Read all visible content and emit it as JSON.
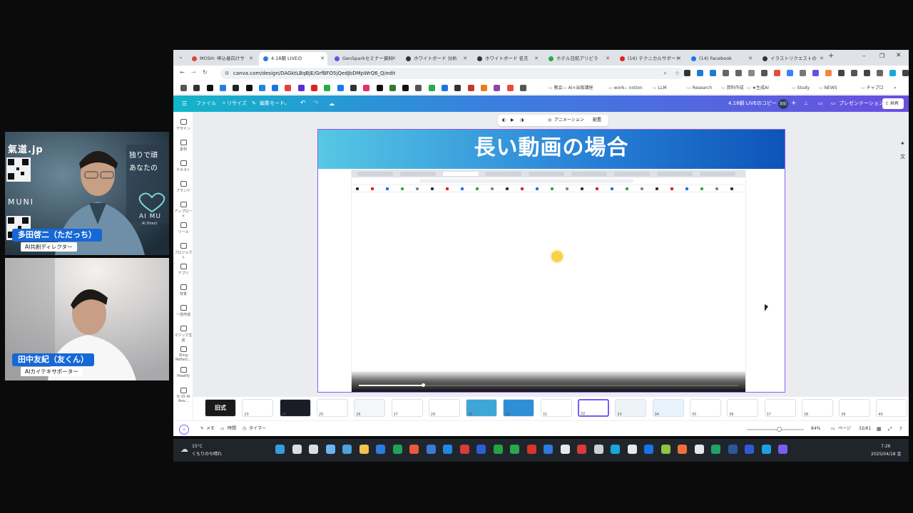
{
  "cams": {
    "top": {
      "name": "多田啓二（ただっち）",
      "role": "AI共創ディレクター",
      "overlay_site": "氣道.jp",
      "overlay_logo": "MUNI",
      "overlay_banner_1": "独りで頑",
      "overlay_banner_2": "あなたの",
      "overlay_brand": "AI MU",
      "overlay_brand_sub": "AI Direct"
    },
    "bottom": {
      "name": "田中友紀（友くん）",
      "role": "AIカイテキサポーター"
    }
  },
  "browser": {
    "tabs": [
      {
        "label": "MOSH: 申込者向けサ",
        "color": "#e0443c"
      },
      {
        "label": "4.18朝 LIVEの",
        "color": "#2d7be0",
        "active": true
      },
      {
        "label": "GenSparkセミナー資料",
        "color": "#6b4fe0"
      },
      {
        "label": "ホワイトボード 分析",
        "color": "#333333"
      },
      {
        "label": "ホワイトボード 名言",
        "color": "#333333"
      },
      {
        "label": "ホテル日航アリビラ",
        "color": "#2aa84a"
      },
      {
        "label": "(16) テクニカルサポート",
        "color": "#e02020"
      },
      {
        "label": "(14) Facebook",
        "color": "#1877f2"
      },
      {
        "label": "イラストリクエストの",
        "color": "#333333"
      }
    ],
    "url": "canva.com/design/DAGktLBqBjE/GrfBFO5jQedJbDMpWrQ6_Q/edit",
    "bookmarks": [
      "教会",
      "AI×出版講座",
      "work",
      "notion",
      "LLM",
      "Research",
      "資料作成",
      "★生成AI",
      "Study",
      "NEWS",
      "チャプロ"
    ]
  },
  "canva": {
    "menu_file": "ファイル",
    "menu_resize": "リサイズ",
    "menu_edit_mode": "編集モード",
    "doc_title": "4.18朝 LIVEのコピー",
    "avatar_initials": "友紀",
    "present_label": "プレゼンテーション",
    "share_label": "共有",
    "rail": [
      "デザイン",
      "素材",
      "テキスト",
      "ブランド",
      "アップロード",
      "ツール",
      "プロジェクト",
      "アプリ",
      "背景",
      "一括作成",
      "マジック生成",
      "Sling Reflect...",
      "Heatify",
      "Q-15 AI Ava..."
    ],
    "ctx_animation": "アニメーション",
    "ctx_position": "配置",
    "slide_title": "長い動画の場合",
    "thumbs": [
      {
        "num": "",
        "caption": "旧式",
        "bg": "#1a1a1a"
      },
      {
        "num": "23",
        "caption": "",
        "bg": "#ffffff"
      },
      {
        "num": "24",
        "caption": "",
        "bg": "#1a1c26"
      },
      {
        "num": "25",
        "caption": "",
        "bg": "#ffffff"
      },
      {
        "num": "26",
        "caption": "",
        "bg": "#f4f6f8"
      },
      {
        "num": "27",
        "caption": "",
        "bg": "#ffffff"
      },
      {
        "num": "28",
        "caption": "",
        "bg": "#ffffff"
      },
      {
        "num": "29",
        "caption": "",
        "bg": "#3fa6d8"
      },
      {
        "num": "30",
        "caption": "",
        "bg": "#2f8fd6"
      },
      {
        "num": "31",
        "caption": "",
        "bg": "#ffffff"
      },
      {
        "num": "32",
        "caption": "",
        "bg": "#ffffff",
        "selected": true
      },
      {
        "num": "33",
        "caption": "",
        "bg": "#eef3f7"
      },
      {
        "num": "34",
        "caption": "",
        "bg": "#e8f2fb"
      },
      {
        "num": "35",
        "caption": "",
        "bg": "#ffffff"
      },
      {
        "num": "36",
        "caption": "",
        "bg": "#ffffff"
      },
      {
        "num": "37",
        "caption": "",
        "bg": "#ffffff"
      },
      {
        "num": "38",
        "caption": "",
        "bg": "#ffffff"
      },
      {
        "num": "39",
        "caption": "",
        "bg": "#ffffff"
      },
      {
        "num": "40",
        "caption": "",
        "bg": "#ffffff"
      }
    ],
    "bottom_memo": "メモ",
    "bottom_time": "時間",
    "bottom_timer": "タイマー",
    "zoom": "84%",
    "page_label": "ページ",
    "page_counter": "32/61"
  },
  "taskbar": {
    "weather_temp": "15°C",
    "weather_desc": "くもりのち晴れ",
    "time": "7:26",
    "date": "2025/04/18 金"
  }
}
